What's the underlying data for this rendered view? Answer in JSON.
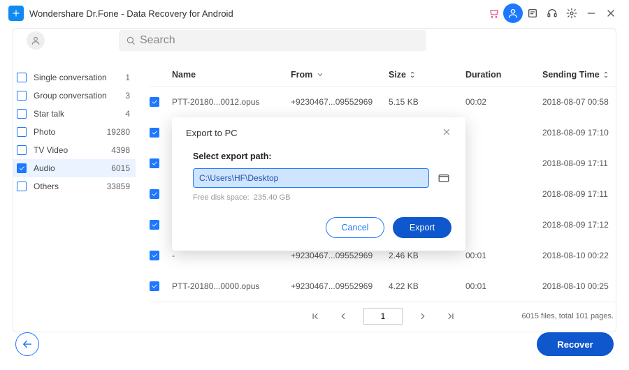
{
  "app": {
    "title": "Wondershare Dr.Fone - Data Recovery for Android"
  },
  "search": {
    "placeholder": "Search"
  },
  "sidebar": {
    "items": [
      {
        "label": "Single conversation",
        "count": "1",
        "checked": false
      },
      {
        "label": "Group conversation",
        "count": "3",
        "checked": false
      },
      {
        "label": "Star talk",
        "count": "4",
        "checked": false
      },
      {
        "label": "Photo",
        "count": "19280",
        "checked": false
      },
      {
        "label": "TV Video",
        "count": "4398",
        "checked": false
      },
      {
        "label": "Audio",
        "count": "6015",
        "checked": true
      },
      {
        "label": "Others",
        "count": "33859",
        "checked": false
      }
    ]
  },
  "table": {
    "headers": {
      "name": "Name",
      "from": "From",
      "size": "Size",
      "duration": "Duration",
      "time": "Sending Time"
    },
    "rows": [
      {
        "name": "PTT-20180...0012.opus",
        "from": "+9230467...09552969",
        "size": "5.15 KB",
        "duration": "00:02",
        "time": "2018-08-07 00:58"
      },
      {
        "name": "",
        "from": "",
        "size": "",
        "duration": "",
        "time": "2018-08-09 17:10"
      },
      {
        "name": "",
        "from": "",
        "size": "",
        "duration": "",
        "time": "2018-08-09 17:11"
      },
      {
        "name": "",
        "from": "",
        "size": "",
        "duration": "",
        "time": "2018-08-09 17:11"
      },
      {
        "name": "",
        "from": "",
        "size": "",
        "duration": "",
        "time": "2018-08-09 17:12"
      },
      {
        "name": "-",
        "from": "+9230467...09552969",
        "size": "2.46 KB",
        "duration": "00:01",
        "time": "2018-08-10 00:22"
      },
      {
        "name": "PTT-20180...0000.opus",
        "from": "+9230467...09552969",
        "size": "4.22 KB",
        "duration": "00:01",
        "time": "2018-08-10 00:25"
      }
    ]
  },
  "pager": {
    "page": "1",
    "summary": "6015 files, total 101 pages."
  },
  "modal": {
    "title": "Export to PC",
    "label": "Select export path:",
    "path": "C:\\Users\\HF\\Desktop",
    "freespace_label": "Free disk space:",
    "freespace_value": "235.40 GB",
    "cancel": "Cancel",
    "export": "Export"
  },
  "recover_label": "Recover"
}
